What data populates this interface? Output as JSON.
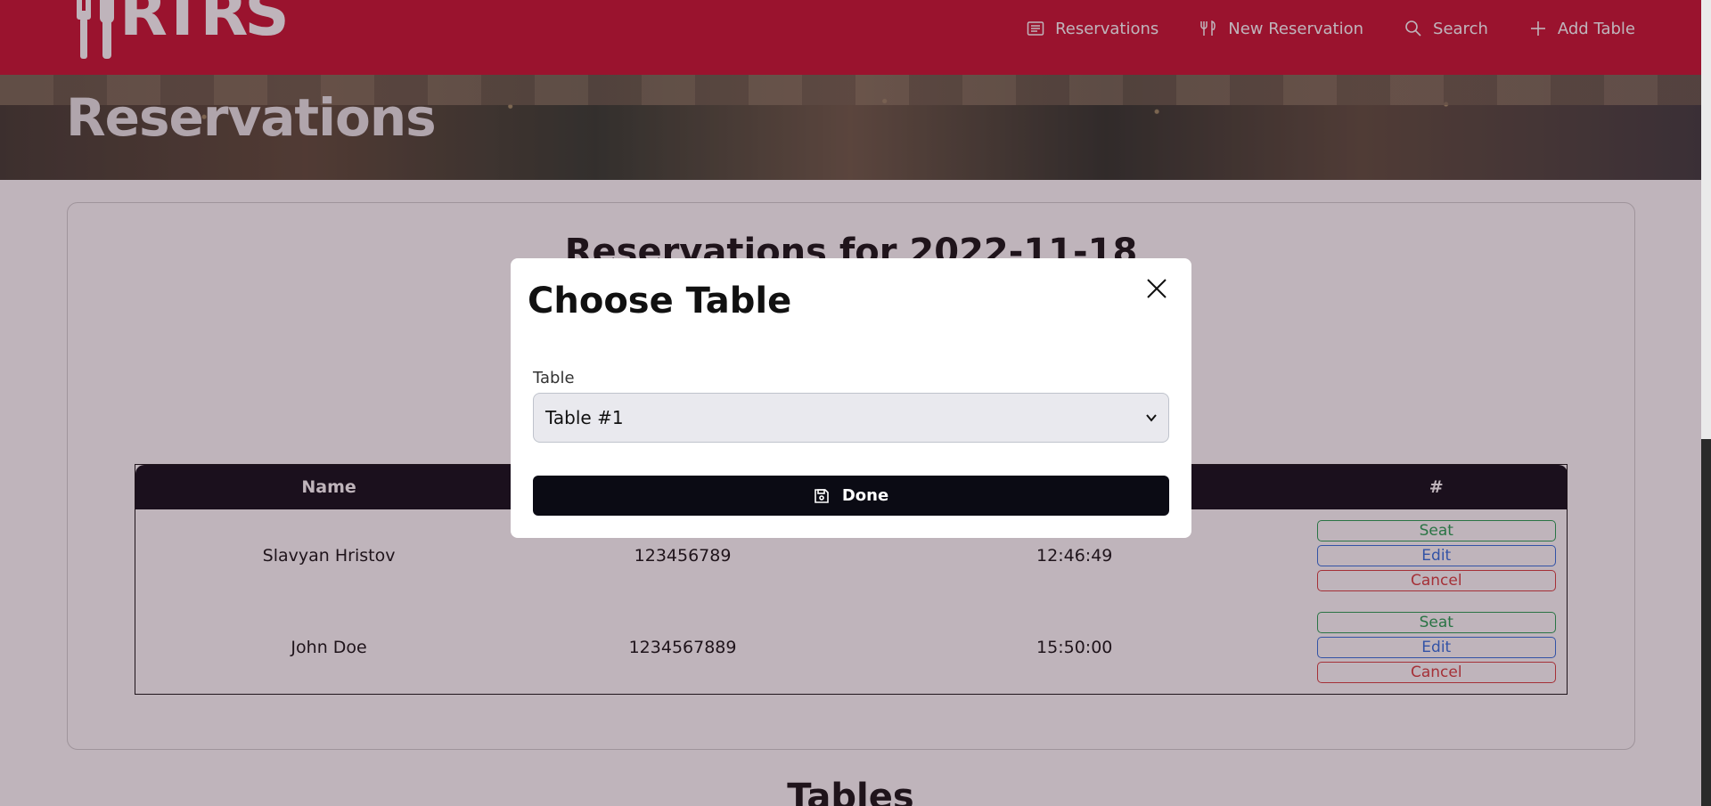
{
  "brand": {
    "logo_text": "RTRS"
  },
  "nav": {
    "items": [
      {
        "label": "Reservations",
        "icon": "list-icon"
      },
      {
        "label": "New Reservation",
        "icon": "utensils-icon"
      },
      {
        "label": "Search",
        "icon": "search-icon"
      },
      {
        "label": "Add Table",
        "icon": "plus-icon"
      }
    ]
  },
  "hero": {
    "title": "Reservations"
  },
  "reservations": {
    "title": "Reservations for 2022-11-18",
    "columns": [
      "Name",
      "",
      "",
      "#"
    ],
    "rows": [
      {
        "name": "Slavyan Hristov",
        "phone": "123456789",
        "time": "12:46:49"
      },
      {
        "name": "John Doe",
        "phone": "1234567889",
        "time": "15:50:00"
      }
    ],
    "actions": {
      "seat": "Seat",
      "edit": "Edit",
      "cancel": "Cancel"
    }
  },
  "tables_section": {
    "title": "Tables"
  },
  "modal": {
    "title": "Choose Table",
    "field_label": "Table",
    "selected": "Table #1",
    "done_label": "Done"
  },
  "colors": {
    "navbar": "#c8102e",
    "dark": "#0b0b14",
    "seat": "#22a050",
    "edit": "#2f6fe0",
    "cancel": "#d83b3b"
  }
}
